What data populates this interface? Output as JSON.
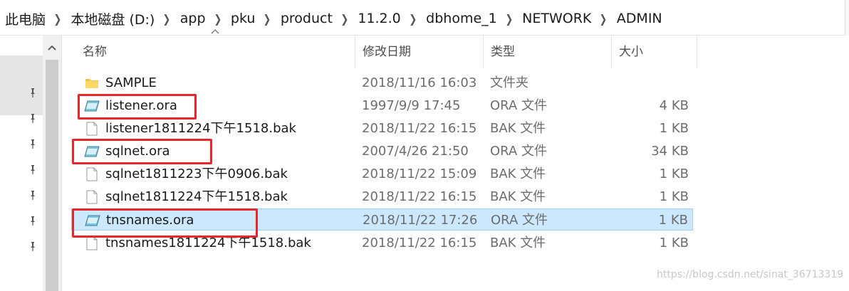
{
  "breadcrumb": {
    "items": [
      "此电脑",
      "本地磁盘 (D:)",
      "app",
      "pku",
      "product",
      "11.2.0",
      "dbhome_1",
      "NETWORK",
      "ADMIN"
    ]
  },
  "columns": {
    "name": "名称",
    "date": "修改日期",
    "type": "类型",
    "size": "大小"
  },
  "files": [
    {
      "name": "SAMPLE",
      "date": "2018/11/16 16:03",
      "type": "文件夹",
      "size": "",
      "icon": "folder-icon",
      "selected": false
    },
    {
      "name": "listener.ora",
      "date": "1997/9/9 17:45",
      "type": "ORA 文件",
      "size": "4 KB",
      "icon": "ora-file-icon",
      "selected": false
    },
    {
      "name": "listener1811224下午1518.bak",
      "date": "2018/11/22 16:15",
      "type": "BAK 文件",
      "size": "1 KB",
      "icon": "blank-file-icon",
      "selected": false
    },
    {
      "name": "sqlnet.ora",
      "date": "2007/4/26 21:50",
      "type": "ORA 文件",
      "size": "34 KB",
      "icon": "ora-file-icon",
      "selected": false
    },
    {
      "name": "sqlnet1811223下午0906.bak",
      "date": "2018/11/22 15:09",
      "type": "BAK 文件",
      "size": "1 KB",
      "icon": "blank-file-icon",
      "selected": false
    },
    {
      "name": "sqlnet1811224下午1518.bak",
      "date": "2018/11/22 16:15",
      "type": "BAK 文件",
      "size": "1 KB",
      "icon": "blank-file-icon",
      "selected": false
    },
    {
      "name": "tnsnames.ora",
      "date": "2018/11/22 17:26",
      "type": "ORA 文件",
      "size": "1 KB",
      "icon": "ora-file-icon",
      "selected": true
    },
    {
      "name": "tnsnames1811224下午1518.bak",
      "date": "2018/11/22 16:15",
      "type": "BAK 文件",
      "size": "1 KB",
      "icon": "blank-file-icon",
      "selected": false
    }
  ],
  "watermark": "https://blog.csdn.net/sinat_36713319",
  "colors": {
    "selection_bg": "#cce8ff",
    "annotation_red": "#e8262c"
  }
}
